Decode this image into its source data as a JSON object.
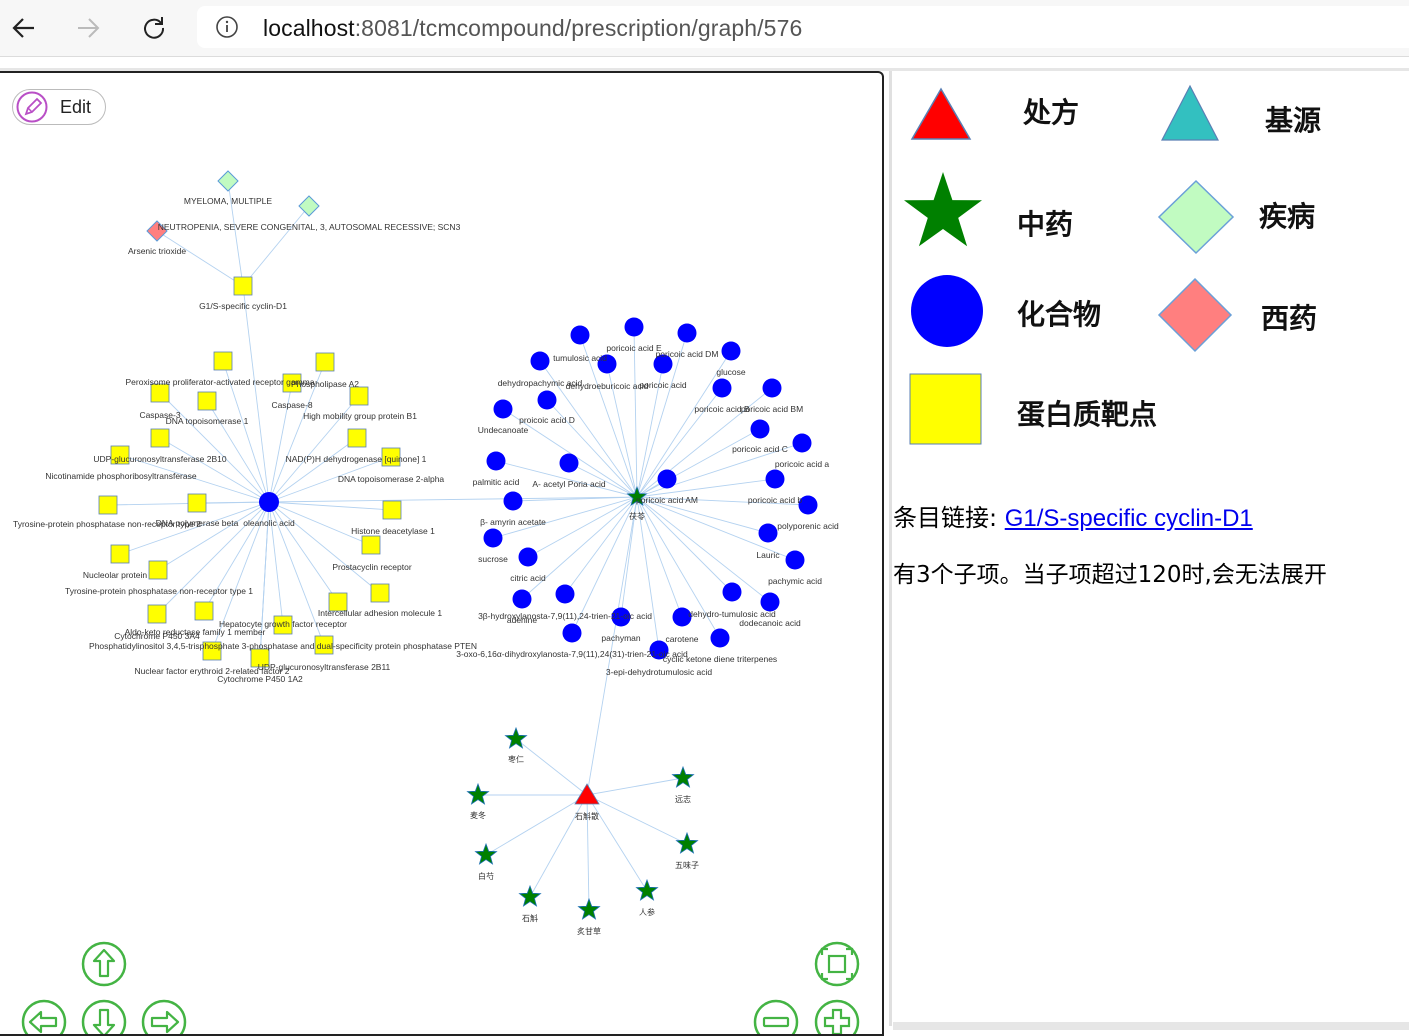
{
  "browser": {
    "url_host": "localhost",
    "url_path": ":8081/tcmcompound/prescription/graph/576",
    "icons": [
      "back-arrow-icon",
      "forward-arrow-icon",
      "reload-icon",
      "info-icon"
    ]
  },
  "graph": {
    "edit_label": "Edit",
    "colors": {
      "compound": "#0000ff",
      "protein": "#ffff00",
      "herb": "#008000",
      "prescription": "#ff0000",
      "disease": "#c1fbc1",
      "drug": "#ff7f7f",
      "edge": "#b4d2f0"
    },
    "protein_labels": [
      "G1/S-specific cyclin-D1",
      "Peroxisome proliferator-activated receptor gamma",
      "Phospholipase A2",
      "Caspase-8",
      "Caspase-3",
      "DNA topoisomerase 1",
      "High mobility group protein B1",
      "NAD(P)H dehydrogenase [quinone] 1",
      "UDP-glucuronosyltransferase 2B10",
      "Nicotinamide phosphoribosyltransferase",
      "DNA topoisomerase 2-alpha",
      "Tyrosine-protein phosphatase non-receptor type 2",
      "DNA polymerase beta",
      "Histone deacetylase 1",
      "Nucleolar protein",
      "Prostacyclin receptor",
      "Tyrosine-protein phosphatase non-receptor type 1",
      "Intercellular adhesion molecule 1",
      "Aldo-keto reductase family 1 member",
      "Cytochrome P450 3A4",
      "Hepatocyte growth factor receptor",
      "Phosphatidylinositol 3,4,5-trisphosphate 3-phosphatase and dual-specificity protein phosphatase PTEN",
      "UDP-glucuronosyltransferase 2B11",
      "Nuclear factor erythroid 2-related factor 2",
      "Cytochrome P450 1A2"
    ],
    "compound_labels": [
      "oleanolic acid",
      "poricoic acid E",
      "tumulosic acid",
      "poricoic acid DM",
      "dehydropachymic acid",
      "dehydroeburicoic acid",
      "poricoic acid",
      "glucose",
      "poricoic acid B",
      "poricoic acid BM",
      "proicoic acid D",
      "Undecanoate",
      "poricoic acid C",
      "palmitic acid",
      "A- acetyl Poria acid",
      "poricoic acid a",
      "poricoic acid AM",
      "poricoic acid b",
      "β- amyrin acetate",
      "polyporenic acid",
      "sucrose",
      "Lauric",
      "citric acid",
      "pachymic acid",
      "3β-hydroxylanosta-7,9(11),24-trien-21-oic acid",
      "adenine",
      "dehydro-tumulosic acid",
      "dodecanoic acid",
      "pachyman",
      "carotene",
      "3-oxo-6,16α-dihydroxylanosta-7,9(11),24(31)-trien-21-oic acid",
      "cyclic ketone diene triterpenes",
      "3-epi-dehydrotumulosic acid"
    ],
    "disease_labels": [
      "MYELOMA, MULTIPLE",
      "NEUTROPENIA, SEVERE CONGENITAL, 3, AUTOSOMAL RECESSIVE; SCN3"
    ],
    "drug_labels": [
      "Arsenic trioxide"
    ],
    "herb_center_label": "茯苓",
    "prescription_label": "石斛散",
    "herb_labels": [
      "枣仁",
      "远志",
      "麦冬",
      "五味子",
      "白芍",
      "人参",
      "石斛",
      "炙甘草"
    ]
  },
  "controls": {
    "icons": [
      "pan-up-icon",
      "pan-left-icon",
      "pan-down-icon",
      "pan-right-icon",
      "fit-view-icon",
      "zoom-out-icon",
      "zoom-in-icon"
    ]
  },
  "legend": {
    "items": [
      {
        "label": "处方",
        "shape": "triangle",
        "color": "#ff0000"
      },
      {
        "label": "基源",
        "shape": "triangle",
        "color": "#33c0c0"
      },
      {
        "label": "中药",
        "shape": "star",
        "color": "#008000"
      },
      {
        "label": "疾病",
        "shape": "diamond",
        "color": "#c1fbc1"
      },
      {
        "label": "化合物",
        "shape": "circle",
        "color": "#0000ff"
      },
      {
        "label": "西药",
        "shape": "diamond",
        "color": "#ff7f7f"
      },
      {
        "label": "蛋白质靶点",
        "shape": "square",
        "color": "#ffff00"
      }
    ]
  },
  "info": {
    "entry_prefix": "条目链接: ",
    "entry_link": "G1/S-specific cyclin-D1",
    "child_text": "有3个子项。当子项超过120时,会无法展开"
  }
}
